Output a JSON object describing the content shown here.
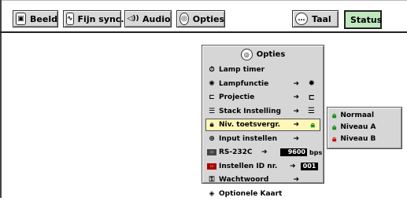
{
  "tabs": [
    {
      "label": "Beeld",
      "icon": "picture-icon"
    },
    {
      "label": "Fijn sync.",
      "icon": "fine-sync-icon"
    },
    {
      "label": "Audio",
      "icon": "speaker-icon"
    },
    {
      "label": "Opties",
      "icon": "options-icon"
    },
    {
      "label": "Taal",
      "icon": "speech-bubble-icon"
    },
    {
      "label": "Status"
    }
  ],
  "menu": {
    "title": "Opties",
    "items": [
      {
        "label": "Lamp timer",
        "icon": "lamp-timer-icon"
      },
      {
        "label": "Lampfunctie",
        "icon": "lamp-icon",
        "arrow": "➜",
        "right_icon": "lamp-mode-icon"
      },
      {
        "label": "Projectie",
        "icon": "projection-icon",
        "arrow": "➜",
        "right_icon": "projection-mode-icon"
      },
      {
        "label": "Stack Instelling",
        "icon": "stack-icon",
        "arrow": "➜",
        "right_icon": "stack-mode-icon"
      },
      {
        "label": "Niv. toetsvergr.",
        "icon": "lock-icon",
        "arrow": "➜",
        "right_icon": "lock-mode-icon",
        "selected": true
      },
      {
        "label": "Input instellen",
        "icon": "input-icon",
        "arrow": "➜"
      },
      {
        "label": "RS-232C",
        "icon": "rs232c-icon",
        "arrow": "➜",
        "value": "9600",
        "unit": "bps"
      },
      {
        "label": "Instellen ID nr.",
        "icon": "id-icon",
        "arrow": "➜",
        "value": "001"
      },
      {
        "label": "Wachtwoord",
        "icon": "key-icon",
        "arrow": "➜"
      },
      {
        "label": "Optionele Kaart",
        "icon": "card-icon"
      }
    ]
  },
  "submenu": {
    "items": [
      {
        "label": "Normaal",
        "icon": "lock-icon",
        "color": "#1a8f1a"
      },
      {
        "label": "Niveau A",
        "icon": "lock-icon",
        "color": "#1a8f1a"
      },
      {
        "label": "Niveau B",
        "icon": "lock-icon",
        "color": "#cc1111"
      }
    ]
  }
}
